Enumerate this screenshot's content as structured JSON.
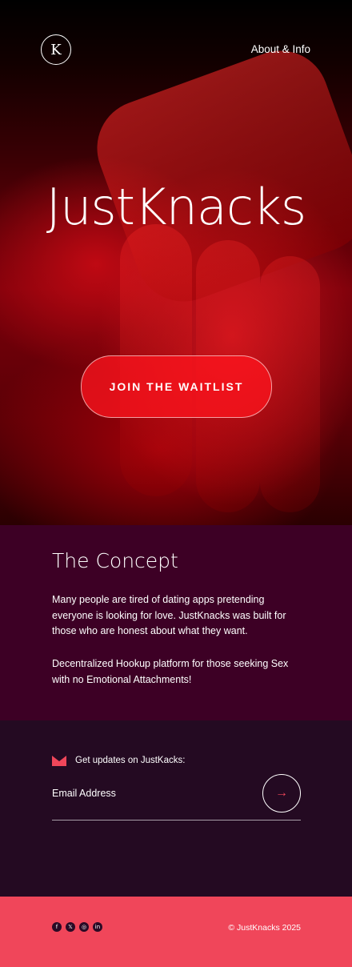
{
  "header": {
    "logo_glyph": "K",
    "nav_link": "About & Info"
  },
  "hero": {
    "brand": "JustKnacks",
    "cta_label": "JOIN THE WAITLIST"
  },
  "concept": {
    "title": "The Concept",
    "paragraph_1": "Many people are tired of dating apps pretending everyone is looking for love. JustKnacks was built for those who are honest about what they want.",
    "paragraph_2": "Decentralized Hookup platform for those seeking Sex with no Emotional Attachments!"
  },
  "signup": {
    "label": "Get updates on JustKacks:",
    "email_placeholder": "Email Address",
    "submit_icon": "arrow-right-icon"
  },
  "footer": {
    "socials": [
      {
        "icon": "facebook-icon",
        "glyph": "f"
      },
      {
        "icon": "x-icon",
        "glyph": "𝕏"
      },
      {
        "icon": "instagram-icon",
        "glyph": "◎"
      },
      {
        "icon": "linkedin-icon",
        "glyph": "in"
      }
    ],
    "copyright": "© JustKnacks 2025"
  },
  "colors": {
    "accent": "#f0465a",
    "concept_bg": "#3d0025",
    "signup_bg": "#240a22"
  }
}
